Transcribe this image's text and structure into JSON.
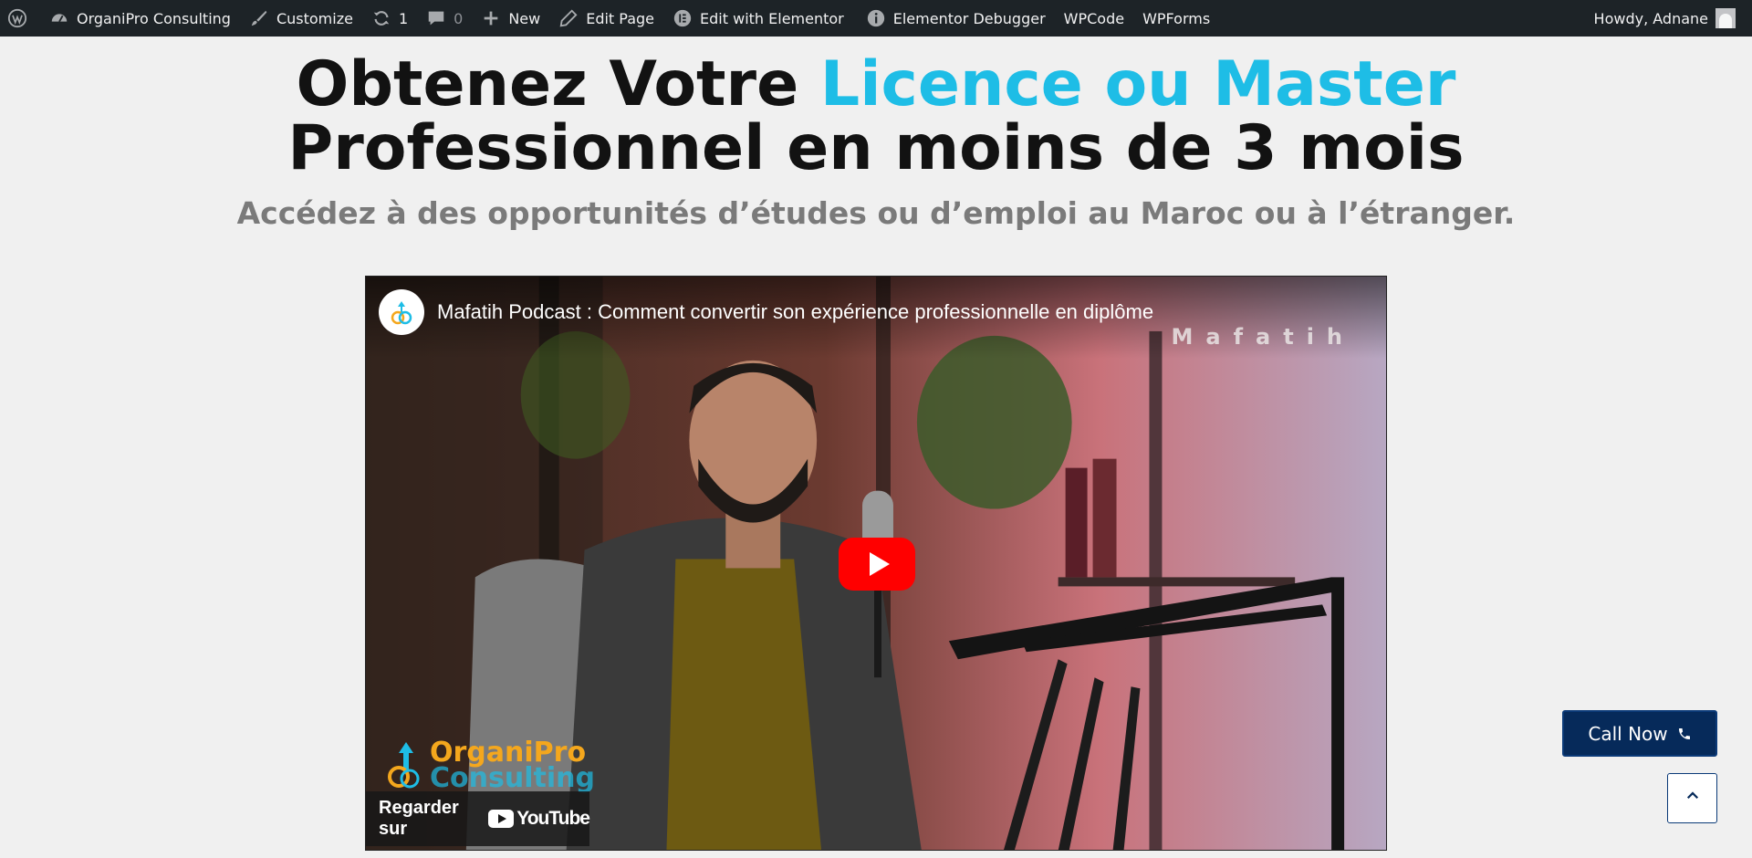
{
  "adminbar": {
    "site_name": "OrganiPro Consulting",
    "customize": "Customize",
    "updates_count": "1",
    "comments_count": "0",
    "new": "New",
    "edit_page": "Edit Page",
    "edit_elementor": "Edit with Elementor",
    "debugger": "Elementor Debugger",
    "wpcode": "WPCode",
    "wpforms": "WPForms",
    "howdy": "Howdy, Adnane"
  },
  "hero": {
    "title_part1": "Obtenez Votre ",
    "title_accent": "Licence ou Master",
    "title_part2": "Professionnel en moins de 3 mois",
    "subtitle": "Accédez à des opportunités d’études ou d’emploi au Maroc ou à l’étranger."
  },
  "video": {
    "title": "Mafatih Podcast : Comment convertir son expérience professionnelle en diplôme",
    "watermark": "Mafatih",
    "watch_on": "Regarder sur",
    "youtube": "YouTube",
    "logo_line1": "OrganiPro",
    "logo_line2": "Consulting"
  },
  "floating": {
    "call_now": "Call Now"
  },
  "colors": {
    "accent": "#1ebde6",
    "call_button": "#062a5a",
    "admin_bar": "#1d2327",
    "youtube_red": "#ff0000"
  },
  "icons": [
    "wordpress-icon",
    "dashboard-icon",
    "brush-icon",
    "updates-icon",
    "comment-icon",
    "plus-icon",
    "pencil-icon",
    "elementor-icon",
    "info-icon",
    "phone-icon",
    "chevron-up-icon"
  ]
}
